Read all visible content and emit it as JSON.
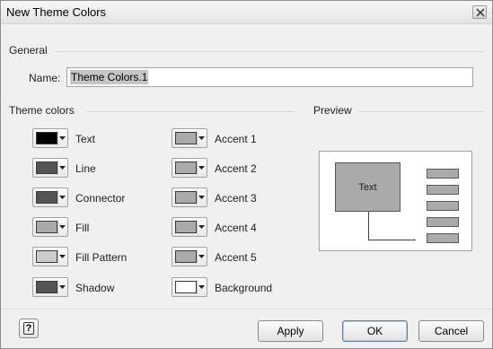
{
  "window": {
    "title": "New Theme Colors",
    "close_icon": "close-icon"
  },
  "general": {
    "group_label": "General",
    "name_label": "Name:",
    "name_value": "Theme Colors.1"
  },
  "theme_colors": {
    "group_label": "Theme colors",
    "left": [
      {
        "label": "Text",
        "color": "#000000"
      },
      {
        "label": "Line",
        "color": "#555555"
      },
      {
        "label": "Connector",
        "color": "#555555"
      },
      {
        "label": "Fill",
        "color": "#aaaaaa"
      },
      {
        "label": "Fill Pattern",
        "color": "#cccccc"
      },
      {
        "label": "Shadow",
        "color": "#555555"
      }
    ],
    "right": [
      {
        "label": "Accent 1",
        "color": "#aaaaaa"
      },
      {
        "label": "Accent 2",
        "color": "#aaaaaa"
      },
      {
        "label": "Accent 3",
        "color": "#aaaaaa"
      },
      {
        "label": "Accent 4",
        "color": "#aaaaaa"
      },
      {
        "label": "Accent 5",
        "color": "#aaaaaa"
      },
      {
        "label": "Background",
        "color": "#ffffff"
      }
    ]
  },
  "preview": {
    "group_label": "Preview",
    "shape_text": "Text"
  },
  "footer": {
    "help_icon": "help-icon",
    "help_glyph": "?",
    "apply_label": "Apply",
    "ok_label": "OK",
    "cancel_label": "Cancel"
  }
}
